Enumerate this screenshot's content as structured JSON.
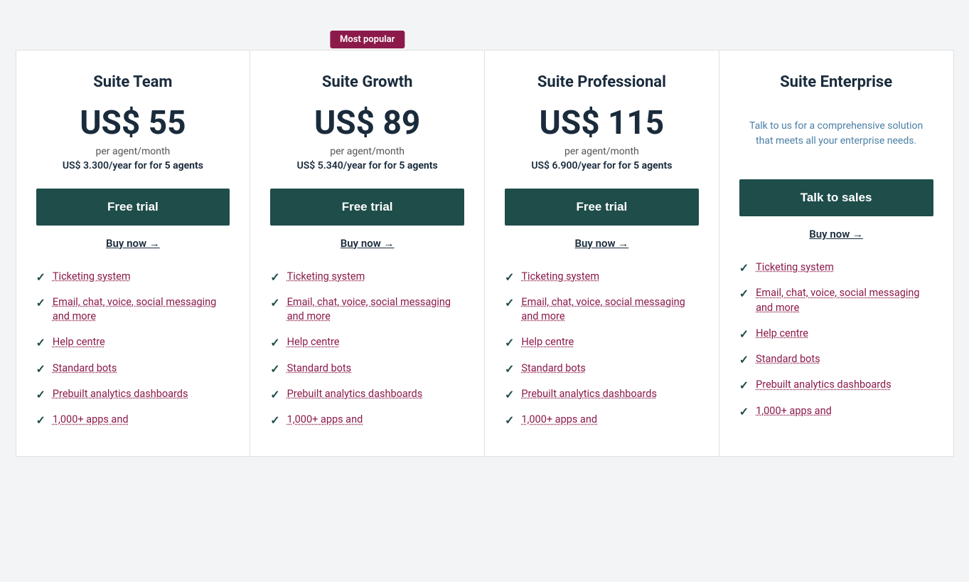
{
  "badge": {
    "label": "Most popular"
  },
  "plans": [
    {
      "id": "suite-team",
      "name": "Suite Team",
      "price": "US$ 55",
      "per_agent": "per agent/month",
      "yearly": "US$ 3.300/year for",
      "agents": "5 agents",
      "cta_primary": "Free trial",
      "cta_secondary": "Buy now →",
      "enterprise": false,
      "features": [
        "Ticketing system",
        "Email, chat, voice, social messaging and more",
        "Help centre",
        "Standard bots",
        "Prebuilt analytics dashboards",
        "1,000+ apps and"
      ]
    },
    {
      "id": "suite-growth",
      "name": "Suite Growth",
      "price": "US$ 89",
      "per_agent": "per agent/month",
      "yearly": "US$ 5.340/year for",
      "agents": "5 agents",
      "cta_primary": "Free trial",
      "cta_secondary": "Buy now →",
      "enterprise": false,
      "most_popular": true,
      "features": [
        "Ticketing system",
        "Email, chat, voice, social messaging and more",
        "Help centre",
        "Standard bots",
        "Prebuilt analytics dashboards",
        "1,000+ apps and"
      ]
    },
    {
      "id": "suite-professional",
      "name": "Suite Professional",
      "price": "US$ 115",
      "per_agent": "per agent/month",
      "yearly": "US$ 6.900/year for",
      "agents": "5 agents",
      "cta_primary": "Free trial",
      "cta_secondary": "Buy now →",
      "enterprise": false,
      "features": [
        "Ticketing system",
        "Email, chat, voice, social messaging and more",
        "Help centre",
        "Standard bots",
        "Prebuilt analytics dashboards",
        "1,000+ apps and"
      ]
    },
    {
      "id": "suite-enterprise",
      "name": "Suite Enterprise",
      "price": null,
      "per_agent": null,
      "yearly": null,
      "agents": null,
      "enterprise": true,
      "enterprise_desc": "Talk to us for a comprehensive solution that meets all your enterprise needs.",
      "cta_primary": "Talk to sales",
      "cta_secondary": "Buy now →",
      "features": [
        "Ticketing system",
        "Email, chat, voice, social messaging and more",
        "Help centre",
        "Standard bots",
        "Prebuilt analytics dashboards",
        "1,000+ apps and"
      ]
    }
  ]
}
